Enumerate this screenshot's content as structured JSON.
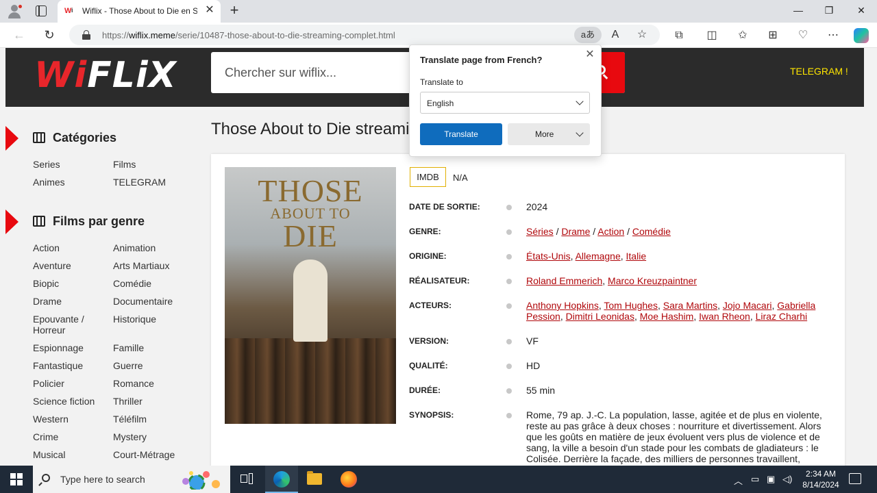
{
  "browser": {
    "tab_title": "Wiflix - Those About to Die en Streaming",
    "url_prefix": "https://",
    "url_host": "wiflix.meme",
    "url_path": "/serie/10487-those-about-to-die-streaming-complet.html",
    "translate_pill": "aあ"
  },
  "site": {
    "logo_w": "Wi",
    "logo_rest": "FLiX",
    "search_placeholder": "Chercher sur wiflix...",
    "telegram_link": "TELEGRAM !"
  },
  "sidebar": {
    "categories_title": "Catégories",
    "categories": [
      "Series",
      "Films",
      "Animes",
      "TELEGRAM"
    ],
    "genres_title": "Films par genre",
    "genres": [
      "Action",
      "Animation",
      "Aventure",
      "Arts Martiaux",
      "Biopic",
      "Comédie",
      "Drame",
      "Documentaire",
      "Epouvante / Horreur",
      "Historique",
      "Espionnage",
      "Famille",
      "Fantastique",
      "Guerre",
      "Policier",
      "Romance",
      "Science fiction",
      "Thriller",
      "Western",
      "Téléfilm",
      "Crime",
      "Mystery",
      "Musical",
      "Court-Métrage"
    ]
  },
  "movie": {
    "title": "Those About to Die streaming",
    "poster_title_1": "THOSE",
    "poster_title_2": "ABOUT TO",
    "poster_title_3": "DIE",
    "imdb_label": "IMDB",
    "imdb_value": "N/A",
    "labels": {
      "release": "DATE DE SORTIE:",
      "genre": "GENRE:",
      "origin": "ORIGINE:",
      "director": "RÉALISATEUR:",
      "actors": "ACTEURS:",
      "version": "VERSION:",
      "quality": "QUALITÉ:",
      "duration": "DURÉE:",
      "synopsis": "SYNOPSIS:"
    },
    "release": "2024",
    "genres": [
      "Séries",
      "Drame",
      "Action",
      "Comédie"
    ],
    "origins": [
      "États-Unis",
      "Allemagne",
      "Italie"
    ],
    "directors": [
      "Roland Emmerich",
      "Marco Kreuzpaintner"
    ],
    "actors": [
      "Anthony Hopkins",
      "Tom Hughes",
      "Sara Martins",
      "Jojo Macari",
      "Gabriella Pession",
      "Dimitri Leonidas",
      "Moe Hashim",
      "Iwan Rheon",
      "Liraz Charhi"
    ],
    "version": "VF",
    "quality": "HD",
    "duration": "55 min",
    "synopsis": "Rome, 79 ap. J.-C. La population, lasse, agitée et de plus en violente, reste au pas grâce à deux choses : nourriture et divertissement. Alors que les goûts en matière de jeux évoluent vers plus de violence et de sang, la ville a besoin d'un stade pour les combats de gladiateurs : le Colisée. Derrière la façade, des milliers de personnes travaillent,"
  },
  "translate_popup": {
    "title": "Translate page from French?",
    "label": "Translate to",
    "selected_language": "English",
    "translate_button": "Translate",
    "more_button": "More"
  },
  "taskbar": {
    "search_placeholder": "Type here to search",
    "time": "2:34 AM",
    "date": "8/14/2024"
  },
  "colors": {
    "accent_red": "#e8090f",
    "link_red": "#b0070b",
    "header_dark": "#2b2b2b",
    "telegram_yellow": "#ffe600",
    "translate_blue": "#0f6cbd"
  }
}
